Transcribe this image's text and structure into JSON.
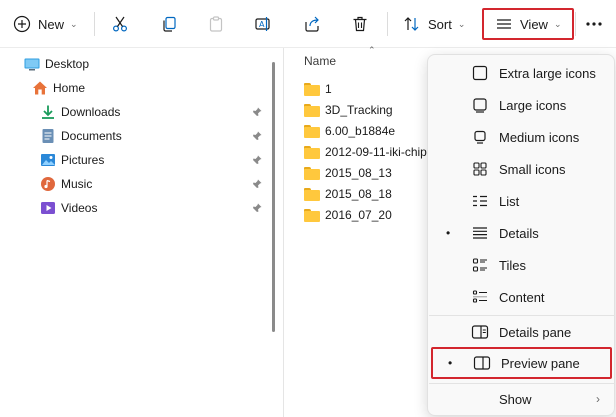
{
  "toolbar": {
    "new_label": "New",
    "sort_label": "Sort",
    "view_label": "View",
    "icons": [
      "plus-circle-icon",
      "cut-icon",
      "copy-icon",
      "paste-icon",
      "rename-icon",
      "share-icon",
      "delete-icon",
      "sort-icon",
      "view-icon",
      "more-icon"
    ]
  },
  "nav": {
    "items": [
      {
        "label": "Desktop",
        "icon": "desktop-icon"
      },
      {
        "label": "Home",
        "icon": "home-icon"
      },
      {
        "label": "Downloads",
        "icon": "downloads-icon",
        "pinned": true
      },
      {
        "label": "Documents",
        "icon": "documents-icon",
        "pinned": true
      },
      {
        "label": "Pictures",
        "icon": "pictures-icon",
        "pinned": true
      },
      {
        "label": "Music",
        "icon": "music-icon",
        "pinned": true
      },
      {
        "label": "Videos",
        "icon": "videos-icon",
        "pinned": true
      }
    ]
  },
  "filelist": {
    "column_name": "Name",
    "rows": [
      "1",
      "3D_Tracking",
      "6.00_b1884e",
      "2012-09-11-iki-chip",
      "2015_08_13",
      "2015_08_18",
      "2016_07_20"
    ]
  },
  "view_menu": {
    "items": [
      {
        "label": "Extra large icons",
        "icon": "extra-large-icons-icon",
        "selected": false
      },
      {
        "label": "Large icons",
        "icon": "large-icons-icon",
        "selected": false
      },
      {
        "label": "Medium icons",
        "icon": "medium-icons-icon",
        "selected": false
      },
      {
        "label": "Small icons",
        "icon": "small-icons-icon",
        "selected": false
      },
      {
        "label": "List",
        "icon": "list-icon",
        "selected": false
      },
      {
        "label": "Details",
        "icon": "details-icon",
        "selected": true
      },
      {
        "label": "Tiles",
        "icon": "tiles-icon",
        "selected": false
      },
      {
        "label": "Content",
        "icon": "content-icon",
        "selected": false
      }
    ],
    "pane_items": [
      {
        "label": "Details pane",
        "icon": "details-pane-icon",
        "selected": false
      },
      {
        "label": "Preview pane",
        "icon": "preview-pane-icon",
        "selected": true
      }
    ],
    "show_label": "Show",
    "bullet": "•",
    "submenu_arrow": "›"
  },
  "colors": {
    "highlight_border": "#d3262e",
    "folder": "#ffc83d",
    "accent": "#0067c0"
  }
}
